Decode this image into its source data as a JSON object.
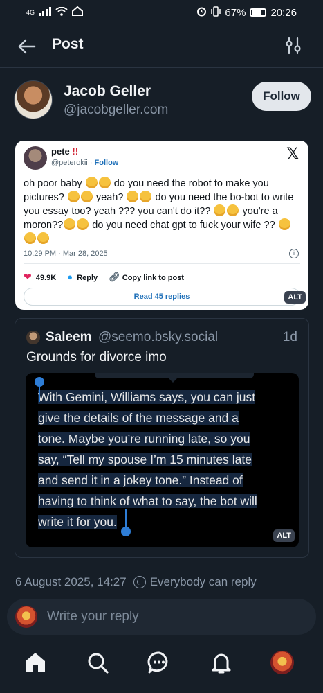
{
  "status_bar": {
    "signal": "4G",
    "battery": "67%",
    "time": "20:26"
  },
  "header": {
    "title": "Post"
  },
  "author": {
    "name": "Jacob Geller",
    "handle": "@jacobgeller.com",
    "follow_label": "Follow"
  },
  "embedded_tweet": {
    "name": "pete",
    "name_marks": "!!",
    "handle": "@peterokii",
    "follow_label": "Follow",
    "x_logo": "𝕏",
    "time": "10:29 PM · Mar 28, 2025",
    "likes": "49.9K",
    "reply_label": "Reply",
    "copy_label": "Copy link to post",
    "read_replies": "Read 45 replies",
    "alt": "ALT"
  },
  "quote": {
    "name": "Saleem",
    "handle": "@seemo.bsky.social",
    "time": "1d",
    "text": "Grounds for divorce imo",
    "image_lines": [
      "With Gemini, Williams says, you can just",
      "give the details of the message and a",
      "tone. Maybe you’re running late, so you",
      "say, “Tell my spouse I’m 15 minutes late",
      "and send it in a jokey tone.” Instead of",
      "having to think of what to say, the bot will",
      "write it for you."
    ],
    "alt": "ALT"
  },
  "post_meta": {
    "datetime": "6 August 2025, 14:27",
    "reply_setting": "Everybody can reply"
  },
  "reply": {
    "placeholder": "Write your reply"
  },
  "tabs": [
    "home-icon",
    "search-icon",
    "chat-icon",
    "bell-icon",
    "profile-avatar"
  ],
  "colors": {
    "background": "#161e27",
    "accent": "#2e7dd6"
  }
}
